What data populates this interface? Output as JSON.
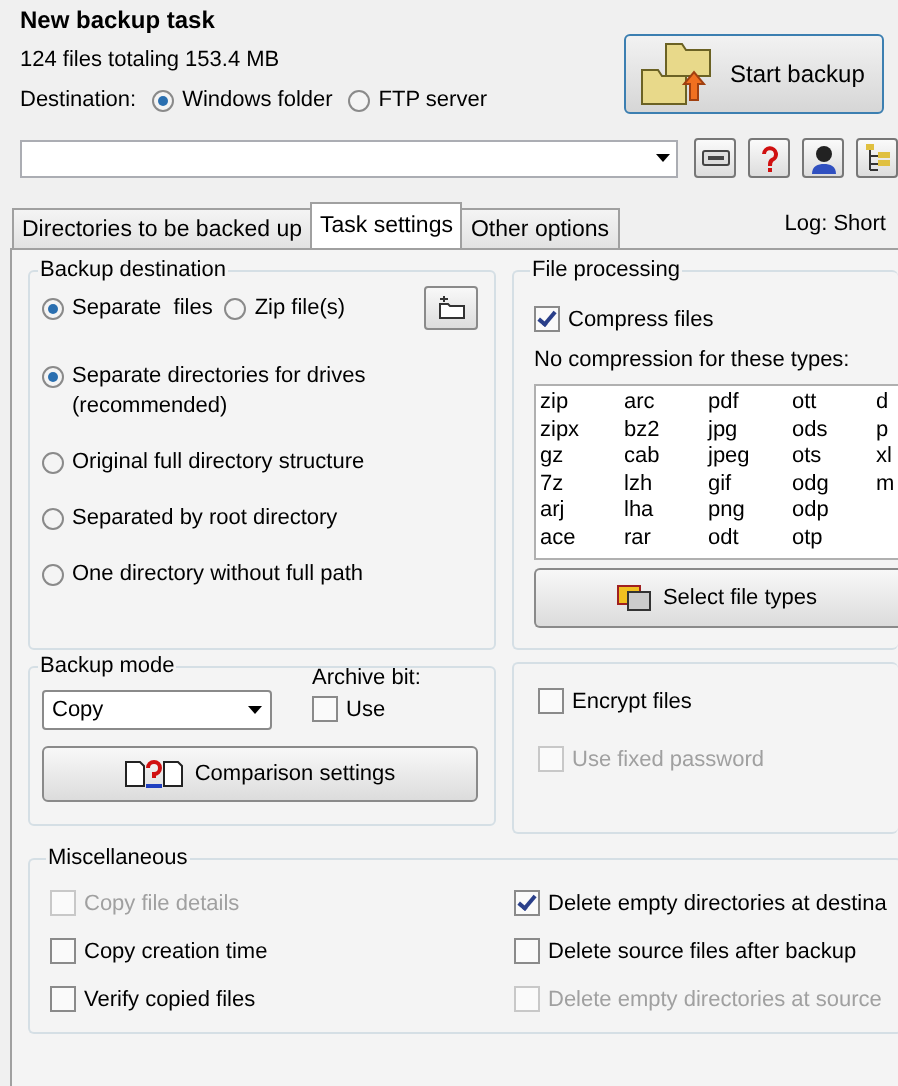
{
  "title": "New backup task",
  "summary": "124 files totaling 153.4 MB",
  "destination": {
    "label": "Destination:",
    "options": [
      {
        "label": "Windows folder",
        "selected": true
      },
      {
        "label": "FTP server",
        "selected": false
      }
    ]
  },
  "start_button": "Start backup",
  "tabs": [
    {
      "label": "Directories to be backed up",
      "selected": false
    },
    {
      "label": "Task settings",
      "selected": true
    },
    {
      "label": "Other options",
      "selected": false
    }
  ],
  "log": "Log: Short",
  "backup_destination": {
    "title": "Backup destination",
    "format_options": [
      {
        "label": "Separate  files",
        "selected": true
      },
      {
        "label": "Zip file(s)",
        "selected": false
      }
    ],
    "structure_options": [
      {
        "label": "Separate directories for drives (recommended)",
        "selected": true
      },
      {
        "label": "Original full directory structure",
        "selected": false
      },
      {
        "label": "Separated by root directory",
        "selected": false
      },
      {
        "label": "One directory without full path",
        "selected": false
      }
    ]
  },
  "file_processing": {
    "title": "File processing",
    "compress": {
      "label": "Compress files",
      "checked": true
    },
    "types_label": "No compression for these types:",
    "file_types": [
      [
        "zip",
        "zipx",
        "gz",
        "7z",
        "arj",
        "ace"
      ],
      [
        "arc",
        "bz2",
        "cab",
        "lzh",
        "lha",
        "rar"
      ],
      [
        "pdf",
        "jpg",
        "jpeg",
        "gif",
        "png",
        "odt"
      ],
      [
        "ott",
        "ods",
        "ots",
        "odg",
        "odp",
        "otp"
      ],
      [
        "d",
        "p",
        "xl",
        "m"
      ]
    ],
    "select_button": "Select file types"
  },
  "backup_mode": {
    "title": "Backup mode",
    "mode": "Copy",
    "archive_label": "Archive bit:",
    "use": {
      "label": "Use",
      "checked": false
    },
    "comparison_button": "Comparison settings"
  },
  "encryption": [
    {
      "label": "Encrypt files",
      "checked": false,
      "disabled": false
    },
    {
      "label": "Use fixed password",
      "checked": false,
      "disabled": true
    }
  ],
  "misc": {
    "title": "Miscellaneous",
    "items": [
      {
        "label": "Copy file details",
        "checked": false,
        "disabled": true
      },
      {
        "label": "Delete empty directories at destina",
        "checked": true,
        "disabled": false
      },
      {
        "label": "Copy creation time",
        "checked": false,
        "disabled": false
      },
      {
        "label": "Delete source files after backup",
        "checked": false,
        "disabled": false
      },
      {
        "label": "Verify copied files",
        "checked": false,
        "disabled": false
      },
      {
        "label": "Delete empty directories at source",
        "checked": false,
        "disabled": true
      }
    ]
  }
}
